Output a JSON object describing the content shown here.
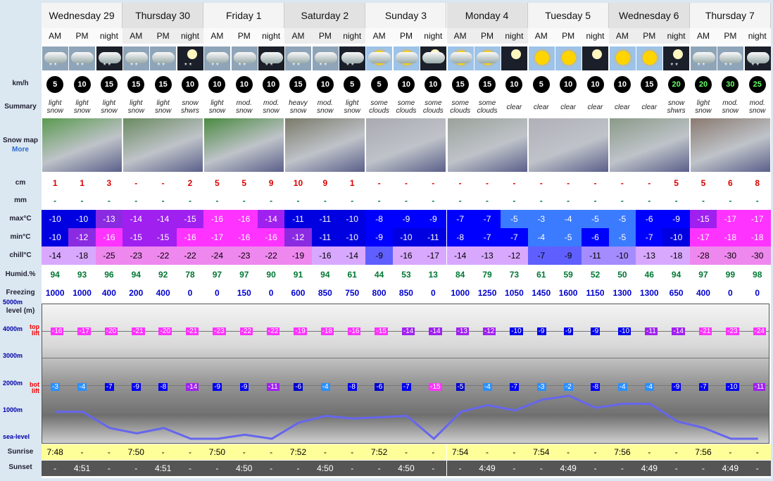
{
  "days": [
    "Wednesday 29",
    "Thursday 30",
    "Friday 1",
    "Saturday 2",
    "Sunday 3",
    "Monday 4",
    "Tuesday 5",
    "Wednesday 6",
    "Thursday 7"
  ],
  "periods": [
    "AM",
    "PM",
    "night"
  ],
  "row_labels": {
    "wind": "km/h",
    "summary": "Summary",
    "snowmap": "Snow map",
    "more": "More",
    "snow": "cm",
    "rain": "mm",
    "max": "max°C",
    "min": "min°C",
    "chill": "chill°C",
    "humid": "Humid.%",
    "freezing": "Freezing level (m)",
    "sunrise": "Sunrise",
    "sunset": "Sunset"
  },
  "icons": [
    "cloud-snow",
    "cloud-snow",
    "cloud-night-snow",
    "cloud-snow",
    "cloud-snow",
    "moon-snow",
    "cloud-snow",
    "cloud-snow",
    "cloud-night-snow",
    "cloud-snow-heavy",
    "cloud-snow",
    "cloud-night-snow",
    "sun-cloud",
    "sun-cloud",
    "moon-cloud",
    "sun-cloud",
    "sun-cloud",
    "moon",
    "sun",
    "sun",
    "moon",
    "sun",
    "sun",
    "moon-snow",
    "cloud-snow",
    "cloud-snow",
    "cloud-night-snow"
  ],
  "wind": [
    "5",
    "10",
    "15",
    "15",
    "15",
    "10",
    "10",
    "10",
    "10",
    "15",
    "10",
    "5",
    "5",
    "10",
    "10",
    "15",
    "15",
    "10",
    "5",
    "10",
    "10",
    "10",
    "15",
    "20",
    "20",
    "30",
    "25"
  ],
  "summary": [
    "light snow",
    "light snow",
    "light snow",
    "light snow",
    "light snow",
    "snow shwrs",
    "light snow",
    "mod. snow",
    "mod. snow",
    "heavy snow",
    "mod. snow",
    "light snow",
    "some clouds",
    "some clouds",
    "some clouds",
    "some clouds",
    "some clouds",
    "clear",
    "clear",
    "clear",
    "clear",
    "clear",
    "clear",
    "snow shwrs",
    "light snow",
    "mod. snow",
    "mod. snow"
  ],
  "snow": [
    "1",
    "1",
    "3",
    "-",
    "-",
    "2",
    "5",
    "5",
    "9",
    "10",
    "9",
    "1",
    "-",
    "-",
    "-",
    "-",
    "-",
    "-",
    "-",
    "-",
    "-",
    "-",
    "-",
    "5",
    "5",
    "6",
    "8"
  ],
  "rain": [
    "-",
    "-",
    "-",
    "-",
    "-",
    "-",
    "-",
    "-",
    "-",
    "-",
    "-",
    "-",
    "-",
    "-",
    "-",
    "-",
    "-",
    "-",
    "-",
    "-",
    "-",
    "-",
    "-",
    "-",
    "-",
    "-",
    "-"
  ],
  "max": [
    "-10",
    "-10",
    "-13",
    "-14",
    "-14",
    "-15",
    "-16",
    "-16",
    "-14",
    "-11",
    "-11",
    "-10",
    "-8",
    "-9",
    "-9",
    "-7",
    "-7",
    "-5",
    "-3",
    "-4",
    "-5",
    "-5",
    "-6",
    "-9",
    "-15",
    "-17",
    "-17"
  ],
  "min": [
    "-10",
    "-12",
    "-16",
    "-15",
    "-15",
    "-16",
    "-17",
    "-16",
    "-16",
    "-12",
    "-11",
    "-10",
    "-9",
    "-10",
    "-11",
    "-8",
    "-7",
    "-7",
    "-4",
    "-5",
    "-6",
    "-5",
    "-7",
    "-10",
    "-17",
    "-18",
    "-18"
  ],
  "chill": [
    "-14",
    "-18",
    "-25",
    "-23",
    "-22",
    "-22",
    "-24",
    "-23",
    "-22",
    "-19",
    "-16",
    "-14",
    "-9",
    "-16",
    "-17",
    "-14",
    "-13",
    "-12",
    "-7",
    "-9",
    "-11",
    "-10",
    "-13",
    "-18",
    "-28",
    "-30",
    "-30"
  ],
  "humid": [
    "94",
    "93",
    "96",
    "94",
    "92",
    "78",
    "97",
    "97",
    "90",
    "91",
    "94",
    "61",
    "44",
    "53",
    "13",
    "84",
    "79",
    "73",
    "61",
    "59",
    "52",
    "50",
    "46",
    "94",
    "97",
    "99",
    "98"
  ],
  "freezing": [
    1000,
    1000,
    400,
    200,
    400,
    0,
    0,
    150,
    0,
    600,
    850,
    750,
    800,
    850,
    0,
    1000,
    1250,
    1050,
    1450,
    1600,
    1150,
    1300,
    1300,
    650,
    400,
    0,
    0
  ],
  "top_lift": [
    "-16",
    "-17",
    "-20",
    "-21",
    "-20",
    "-21",
    "-23",
    "-22",
    "-22",
    "-19",
    "-18",
    "-16",
    "-15",
    "-14",
    "-14",
    "-13",
    "-12",
    "-10",
    "-9",
    "-9",
    "-9",
    "-10",
    "-11",
    "-14",
    "-21",
    "-23",
    "-24"
  ],
  "bot_lift": [
    "-3",
    "-4",
    "-7",
    "-9",
    "-8",
    "-14",
    "-9",
    "-9",
    "-11",
    "-6",
    "-4",
    "-8",
    "-6",
    "-7",
    "-15",
    "-5",
    "-4",
    "-7",
    "-3",
    "-2",
    "-8",
    "-4",
    "-4",
    "-9",
    "-7",
    "-10",
    "-11"
  ],
  "elevation_labels": [
    "5000m",
    "4000m",
    "3000m",
    "2000m",
    "1000m",
    "sea-level"
  ],
  "lift_labels": {
    "top": "top lift",
    "bot": "bot lift"
  },
  "sunrise": [
    "7:48",
    "7:50",
    "7:50",
    "7:52",
    "7:52",
    "7:54",
    "7:54",
    "7:56",
    "7:56"
  ],
  "sunset": [
    "4:51",
    "4:51",
    "4:50",
    "4:50",
    "4:50",
    "4:49",
    "4:49",
    "4:49",
    "4:49"
  ],
  "colors": {
    "freezing_line": "#6666ee",
    "sunrise_bg": "#ffff99",
    "sunset_bg": "#555555"
  }
}
